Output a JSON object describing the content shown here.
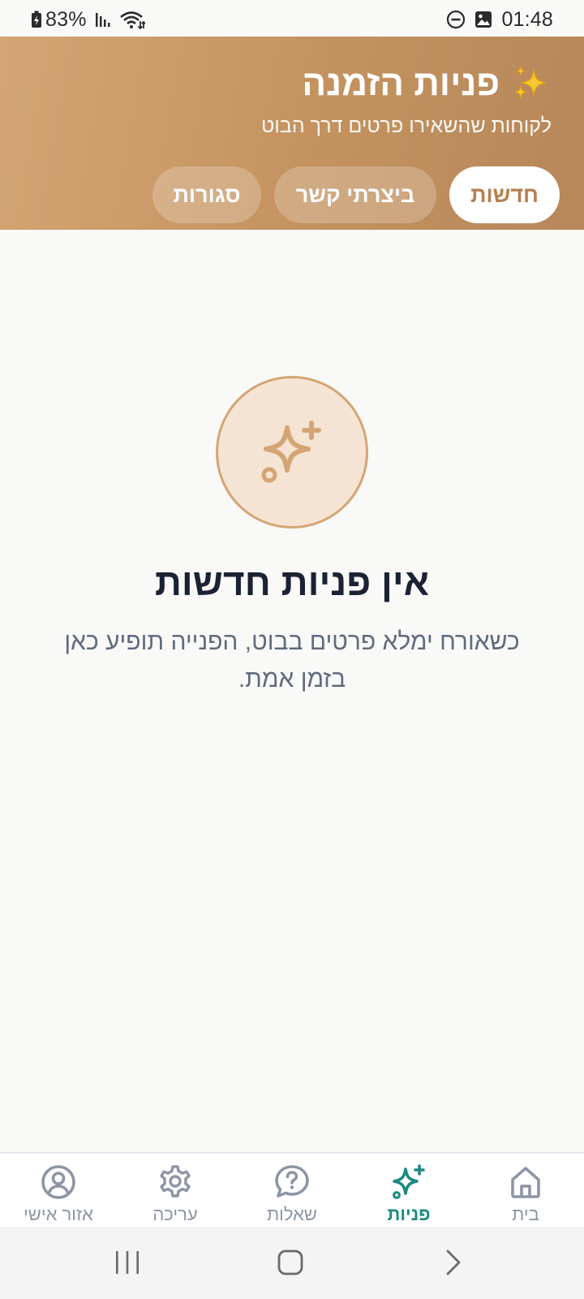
{
  "status_bar": {
    "battery": "83%",
    "time": "01:48",
    "icons": [
      "battery-charging-icon",
      "signal-icon",
      "wifi-icon",
      "do-not-disturb-icon",
      "gallery-icon"
    ]
  },
  "header": {
    "title": "פניות הזמנה",
    "title_icon": "sparkles-emoji-icon",
    "subtitle": "לקוחות שהשאירו פרטים דרך הבוט"
  },
  "tabs": [
    {
      "label": "חדשות",
      "active": true
    },
    {
      "label": "ביצרתי קשר",
      "active": false
    },
    {
      "label": "סגורות",
      "active": false
    }
  ],
  "empty_state": {
    "icon": "sparkle-plus-icon",
    "title": "אין פניות חדשות",
    "description": "כשאורח ימלא פרטים בבוט, הפנייה תופיע כאן בזמן אמת."
  },
  "bottom_nav": [
    {
      "label": "בית",
      "icon": "home-icon",
      "active": false
    },
    {
      "label": "פניות",
      "icon": "sparkle-plus-icon",
      "active": true
    },
    {
      "label": "שאלות",
      "icon": "question-chat-icon",
      "active": false
    },
    {
      "label": "עריכה",
      "icon": "gear-icon",
      "active": false
    },
    {
      "label": "אזור אישי",
      "icon": "user-circle-icon",
      "active": false
    }
  ],
  "colors": {
    "header_gradient_start": "#d4a574",
    "header_gradient_end": "#b8875a",
    "active_tab_text": "#b5804e",
    "nav_active": "#1a8a80",
    "nav_inactive": "#8c96a6",
    "empty_icon_bg": "#f5e4d4"
  }
}
